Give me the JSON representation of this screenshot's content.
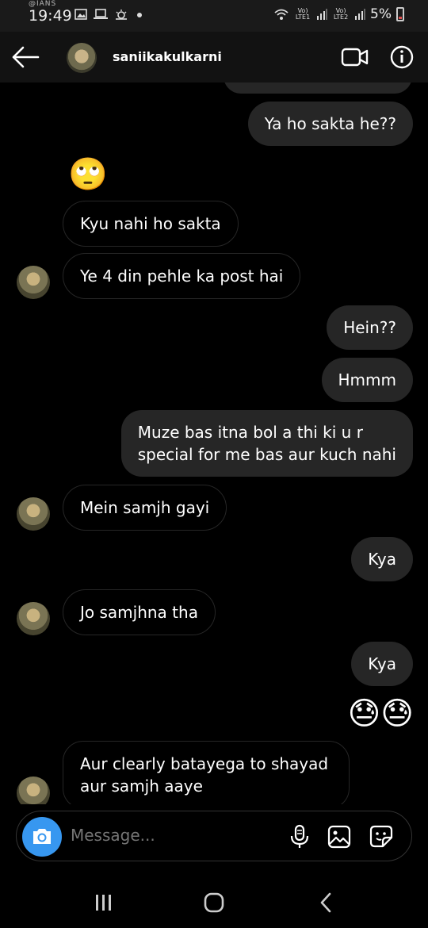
{
  "status_bar": {
    "carrier_top": "@IANS",
    "time": "19:49",
    "lte1": "Vo) LTE1",
    "lte2": "Vo) LTE2",
    "battery": "5%"
  },
  "header": {
    "username": "saniikakulkarni"
  },
  "messages": [
    {
      "id": "m1",
      "direction": "outgoing",
      "text": "Ya ho sakta he??"
    },
    {
      "id": "m2",
      "direction": "incoming",
      "text": "🙄",
      "kind": "emoji"
    },
    {
      "id": "m3",
      "direction": "incoming",
      "text": "Kyu nahi ho sakta"
    },
    {
      "id": "m4",
      "direction": "incoming",
      "text": "Ye 4 din pehle ka post hai"
    },
    {
      "id": "m5",
      "direction": "outgoing",
      "text": "Hein??"
    },
    {
      "id": "m6",
      "direction": "outgoing",
      "text": "Hmmm"
    },
    {
      "id": "m7",
      "direction": "outgoing",
      "line1": "Muze bas itna bol a thi ki u r",
      "line2": "special for me bas aur kuch nahi"
    },
    {
      "id": "m8",
      "direction": "incoming",
      "text": "Mein samjh gayi"
    },
    {
      "id": "m9",
      "direction": "outgoing",
      "text": "Kya"
    },
    {
      "id": "m10",
      "direction": "incoming",
      "text": "Jo samjhna tha"
    },
    {
      "id": "m11",
      "direction": "outgoing",
      "text": "Kya"
    },
    {
      "id": "m12",
      "direction": "outgoing",
      "text": "😓😓",
      "kind": "emoji"
    },
    {
      "id": "m13",
      "direction": "incoming",
      "line1": "Aur clearly batayega to shayad",
      "line2": "aur samjh aaye"
    }
  ],
  "composer": {
    "placeholder": "Message..."
  },
  "icons": {
    "back": "arrow-left-icon",
    "video": "video-camera-icon",
    "info": "info-icon",
    "camera": "camera-icon",
    "mic": "microphone-icon",
    "gallery": "gallery-icon",
    "sticker": "sticker-icon"
  },
  "colors": {
    "background": "#000000",
    "bubble": "#262626",
    "accent": "#3797f0",
    "placeholder": "#8e8e8e"
  }
}
